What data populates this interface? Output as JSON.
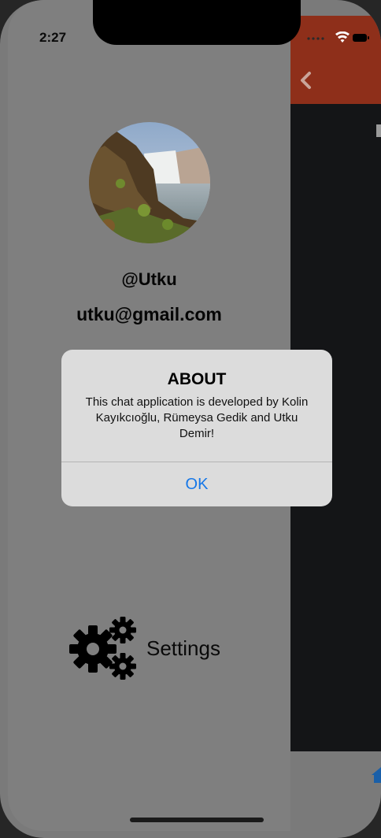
{
  "status_bar": {
    "time": "2:27"
  },
  "profile": {
    "username": "@Utku",
    "email": "utku@gmail.com"
  },
  "menu": {
    "settings_label": "Settings"
  },
  "alert": {
    "title": "ABOUT",
    "message": "This chat application is developed by Kolin Kayıkcıoğlu, Rümeysa Gedik and Utku Demir!",
    "ok_label": "OK"
  },
  "colors": {
    "header": "#8e2f1a",
    "drawer": "#7f7f7f",
    "alert_button": "#1577e8"
  }
}
